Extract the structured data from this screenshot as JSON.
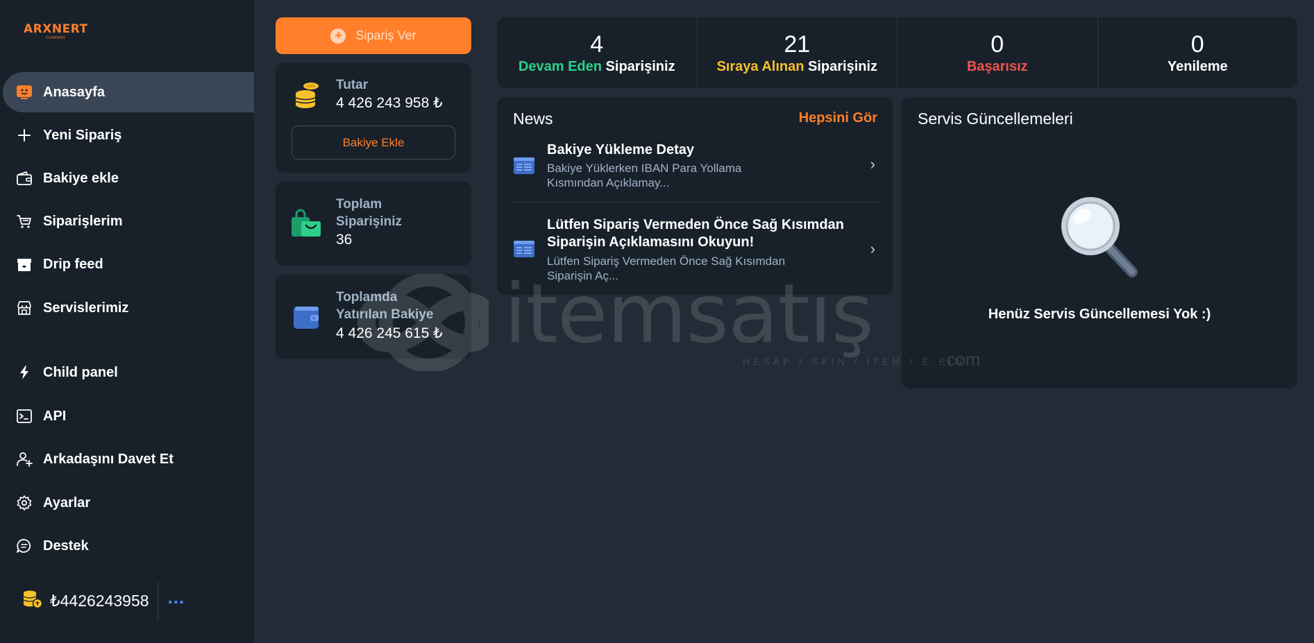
{
  "brand": {
    "logo_text": "ARXNERT",
    "logo_sub": "COMPANY"
  },
  "sidebar": {
    "items": [
      {
        "label": "Anasayfa",
        "icon": "home-monitor-icon",
        "active": true
      },
      {
        "label": "Yeni Sipariş",
        "icon": "plus-icon"
      },
      {
        "label": "Bakiye ekle",
        "icon": "wallet-icon"
      },
      {
        "label": "Siparişlerim",
        "icon": "cart-icon"
      },
      {
        "label": "Drip feed",
        "icon": "gift-box-icon"
      },
      {
        "label": "Servislerimiz",
        "icon": "store-icon"
      },
      {
        "label": "Child panel",
        "icon": "lightning-icon"
      },
      {
        "label": "API",
        "icon": "terminal-icon"
      },
      {
        "label": "Arkadaşını Davet Et",
        "icon": "add-user-icon"
      },
      {
        "label": "Ayarlar",
        "icon": "gear-icon"
      },
      {
        "label": "Destek",
        "icon": "chat-icon"
      }
    ],
    "balance": "₺4426243958",
    "more": "..."
  },
  "order_button": {
    "label": "Sipariş Ver"
  },
  "cards": {
    "amount": {
      "title": "Tutar",
      "value": "4 426 243 958 ₺",
      "button": "Bakiye Ekle"
    },
    "total_orders": {
      "title_line1": "Toplam",
      "title_line2": "Siparişiniz",
      "value": "36"
    },
    "total_deposit": {
      "title_line1": "Toplamda",
      "title_line2": "Yatırılan Bakiye",
      "value": "4 426 245 615 ₺"
    }
  },
  "stats": [
    {
      "num": "4",
      "label_colored": "Devam Eden",
      "label_rest": " Siparişiniz",
      "color": "#2fcf8a"
    },
    {
      "num": "21",
      "label_colored": "Sıraya Alınan",
      "label_rest": " Siparişiniz",
      "color": "#f7c12b"
    },
    {
      "num": "0",
      "label_colored": "Başarısız",
      "label_rest": "",
      "color": "#ef5350"
    },
    {
      "num": "0",
      "label_colored": "",
      "label_rest": "Yenileme",
      "color": "#ffffff"
    }
  ],
  "news": {
    "title": "News",
    "see_all": "Hepsini Gör",
    "items": [
      {
        "title": "Bakiye Yükleme Detay",
        "desc": "Bakiye Yüklerken IBAN Para Yollama Kısmından Açıklamay..."
      },
      {
        "title": "Lütfen Sipariş Vermeden Önce Sağ Kısımdan Siparişin Açıklamasını Okuyun!",
        "desc": "Lütfen Sipariş Vermeden Önce Sağ Kısımdan Siparişin Aç..."
      }
    ]
  },
  "updates": {
    "title": "Servis Güncellemeleri",
    "empty_text": "Henüz Servis Güncellemesi Yok :)"
  },
  "watermark": {
    "text": "itemsatış",
    "sub": "HESAP / SKIN / ITEM / E-PIN",
    "com": ".com"
  },
  "colors": {
    "accent": "#ff7f2a",
    "panel": "#18212a",
    "background": "#222b36"
  }
}
